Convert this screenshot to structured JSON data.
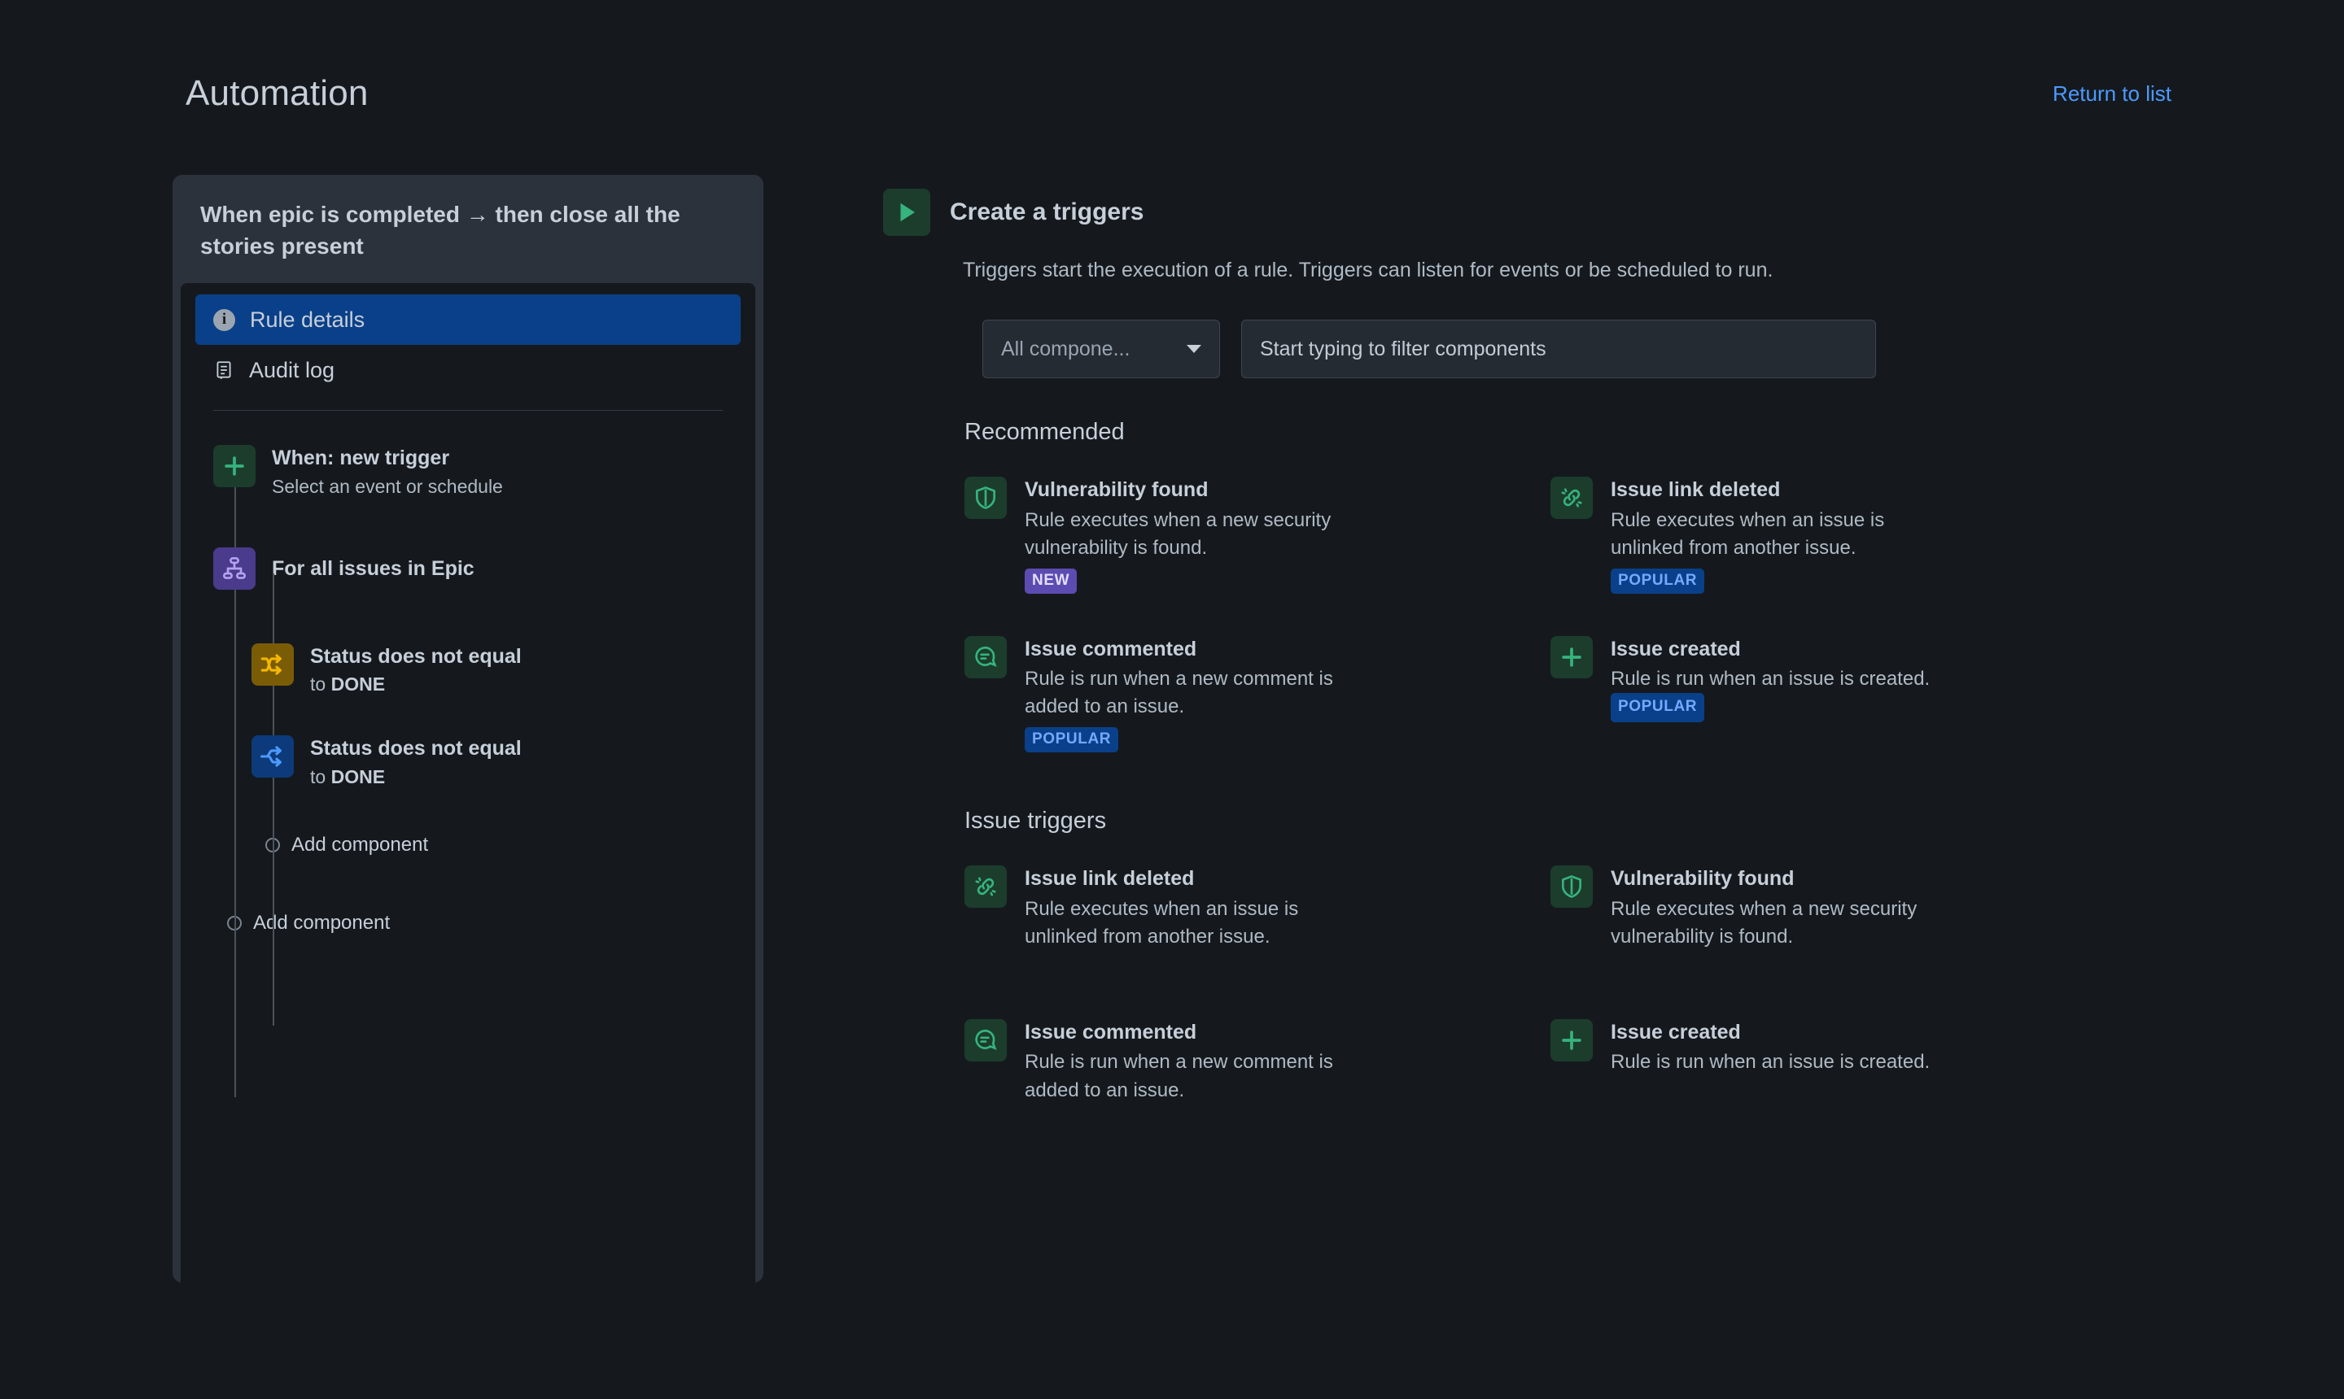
{
  "header": {
    "title": "Automation",
    "return_link": "Return to list"
  },
  "rule_card": {
    "title": "When epic is completed → then close all the stories present",
    "nav": [
      {
        "label": "Rule details",
        "icon": "info-icon",
        "active": true
      },
      {
        "label": "Audit log",
        "icon": "audit-log-icon",
        "active": false
      }
    ],
    "tree": {
      "trigger": {
        "title": "When: new trigger",
        "subtitle": "Select an event or schedule",
        "icon": "plus-icon",
        "icon_bg": "#1c3d2c",
        "icon_color": "#36b37e"
      },
      "branch": {
        "title": "For all issues in Epic",
        "icon": "hierarchy-icon",
        "icon_bg": "#4a3b8c",
        "icon_color": "#b3a3f0"
      },
      "children": [
        {
          "title": "Status does not equal",
          "sub_prefix": "to ",
          "sub_value": "DONE",
          "icon": "condition-shuffle-icon",
          "icon_bg": "#7a5c06",
          "icon_color": "#f5b700"
        },
        {
          "title": "Status does not equal",
          "sub_prefix": "to ",
          "sub_value": "DONE",
          "icon": "branch-arrow-icon",
          "icon_bg": "#0d3a7a",
          "icon_color": "#4c9aff"
        }
      ],
      "add_component_nested": "Add component",
      "add_component_root": "Add component"
    }
  },
  "right_panel": {
    "section_title": "Create a triggers",
    "section_icon": "play-icon",
    "section_description": "Triggers start the execution of a rule. Triggers can listen for events or be scheduled to run.",
    "filters": {
      "select_value": "All compone...",
      "select_icon": "chevron-down-icon",
      "search_placeholder": "Start typing to filter components",
      "search_value": ""
    },
    "groups": [
      {
        "title": "Recommended",
        "items": [
          {
            "name": "Vulnerability found",
            "description": "Rule executes when a new security vulnerability is found.",
            "icon": "shield-icon",
            "badge": "NEW",
            "badge_type": "new",
            "badge_inline": false
          },
          {
            "name": "Issue link deleted",
            "description": "Rule executes when an issue is unlinked from another issue.",
            "icon": "broken-link-icon",
            "badge": "POPULAR",
            "badge_type": "popular",
            "badge_inline": false
          },
          {
            "name": "Issue commented",
            "description": "Rule is run when a new comment is added to an issue.",
            "icon": "comment-icon",
            "badge": "POPULAR",
            "badge_type": "popular",
            "badge_inline": false
          },
          {
            "name": "Issue created",
            "description": "Rule is run when an issue is created.",
            "icon": "plus-icon",
            "badge": "POPULAR",
            "badge_type": "popular",
            "badge_inline": true
          }
        ]
      },
      {
        "title": "Issue triggers",
        "items": [
          {
            "name": "Issue link deleted",
            "description": "Rule executes when an issue is unlinked from another issue.",
            "icon": "broken-link-icon",
            "badge": "",
            "badge_type": "",
            "badge_inline": false
          },
          {
            "name": "Vulnerability found",
            "description": "Rule executes when a new security vulnerability is found.",
            "icon": "shield-icon",
            "badge": "",
            "badge_type": "",
            "badge_inline": false
          },
          {
            "name": "Issue commented",
            "description": "Rule is run when a new comment is added to an issue.",
            "icon": "comment-icon",
            "badge": "",
            "badge_type": "",
            "badge_inline": false
          },
          {
            "name": "Issue created",
            "description": "Rule is run when an issue is created.",
            "icon": "plus-icon",
            "badge": "",
            "badge_type": "",
            "badge_inline": false
          }
        ]
      }
    ]
  },
  "colors": {
    "page_bg": "#15191d",
    "card_bg": "#2b323c",
    "accent_blue": "#4c9aff",
    "active_nav": "#0a4089",
    "green": "#36b37e",
    "amber": "#f5b700",
    "purple": "#b3a3f0"
  }
}
